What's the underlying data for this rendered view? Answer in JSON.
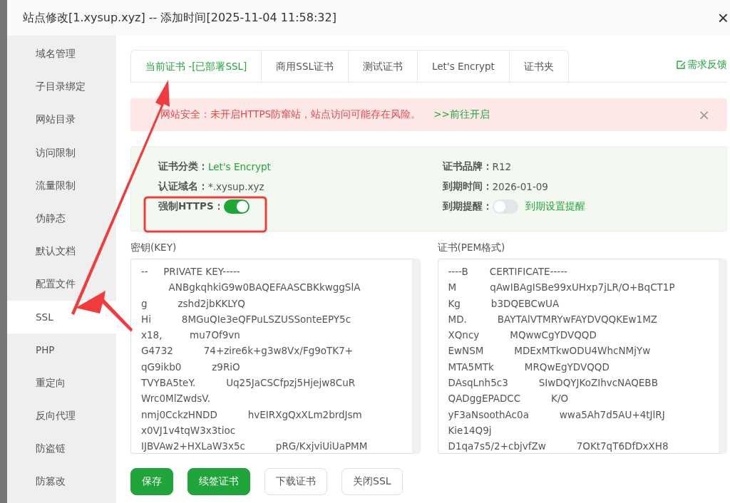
{
  "window": {
    "title": "站点修改[1.xysup.xyz] -- 添加时间[2025-11-04 11:58:32]",
    "close": "×"
  },
  "sidebar": {
    "items": [
      {
        "label": "域名管理",
        "selected": false
      },
      {
        "label": "子目录绑定",
        "selected": false
      },
      {
        "label": "网站目录",
        "selected": false
      },
      {
        "label": "访问限制",
        "selected": false
      },
      {
        "label": "流量限制",
        "selected": false
      },
      {
        "label": "伪静态",
        "selected": false
      },
      {
        "label": "默认文档",
        "selected": false
      },
      {
        "label": "配置文件",
        "selected": false
      },
      {
        "label": "SSL",
        "selected": true
      },
      {
        "label": "PHP",
        "selected": false
      },
      {
        "label": "重定向",
        "selected": false
      },
      {
        "label": "反向代理",
        "selected": false
      },
      {
        "label": "防盗链",
        "selected": false
      },
      {
        "label": "防篡改",
        "selected": false
      }
    ]
  },
  "tabs": [
    {
      "label": "当前证书 -[已部署SSL]",
      "selected": true
    },
    {
      "label": "商用SSL证书",
      "selected": false
    },
    {
      "label": "测试证书",
      "selected": false
    },
    {
      "label": "Let's Encrypt",
      "selected": false
    },
    {
      "label": "证书夹",
      "selected": false
    }
  ],
  "feedback_link": "需求反馈",
  "alert": {
    "text": "网站安全：未开启HTTPS防窜站，站点访问可能存在风险。",
    "link": ">>前往开启",
    "close": "×"
  },
  "cert_info": {
    "left": [
      {
        "kind": "text",
        "label": "证书分类：",
        "value": "Let's Encrypt",
        "highlight": true
      },
      {
        "kind": "text",
        "label": "认证域名：",
        "value": "*.xysup.xyz",
        "highlight": false
      },
      {
        "kind": "toggle",
        "label": "强制HTTPS：",
        "on": true
      }
    ],
    "right": [
      {
        "kind": "text",
        "label": "证书品牌：",
        "value": "R12",
        "highlight": false
      },
      {
        "kind": "text",
        "label": "到期时间：",
        "value": "2026-01-09",
        "highlight": false
      },
      {
        "kind": "toggle",
        "label": "到期提醒：",
        "on": false,
        "link": "到期设置提醒"
      }
    ]
  },
  "key": {
    "label": "密钥(KEY)",
    "lines": [
      "--     PRIVATE KEY-----",
      "         ANBgkqhkiG9w0BAQEFAASCBKkwggSlA",
      "g          zshd2jbKKLYQ",
      "Hi          8MGuQIe3eQFPuLSZUSSonteEPY5c",
      "x18,         mu7Of9vn",
      "G4732          74+zire6k+g3w8Vx/Fg9oTK7+",
      "qG9ikb0          z9RiO",
      "TVYBA5teY.          Uq25JaCSCfpzj5Hjejw8CuR",
      "Wrc0MlZwdsV.",
      "nmj0CckzHNDD          hvEIRXgQxXLm2brdJsm",
      "x0VJ1v4tqW3x3tioc",
      "IJBVAw2+HXLaW3x5c          pRG/KxjviUiUaPMM"
    ]
  },
  "cert": {
    "label": "证书(PEM格式)",
    "lines": [
      "----B       CERTIFICATE-----",
      "M           qAwIBAgISBe99xUHxp7jLR/O+BqCT1P",
      "Kg          b3DQEBCwUA",
      "MD.          BAYTAlVTMRYwFAYDVQQKEw1MZ",
      "XQncy          MQwwCgYDVQQD",
      "EwNSM          MDExMTkwODU4WhcNMjYw",
      "MTA5MTk          MRQwEgYDVQQD",
      "DAsqLnh5c3          SIwDQYJKoZIhvcNAQEBB",
      "QADggEPADCC          K/O",
      "yF3aNsoothAc0a          wwa5Ah7d5AU+4tJlRJ",
      "Kie14Q9j",
      "D1qa7s5/2+cbjvfZw          7OKt7qT6DfDxXH8"
    ]
  },
  "buttons": [
    {
      "label": "保存",
      "primary": true
    },
    {
      "label": "续签证书",
      "primary": true
    },
    {
      "label": "下载证书",
      "primary": false
    },
    {
      "label": "关闭SSL",
      "primary": false
    }
  ]
}
